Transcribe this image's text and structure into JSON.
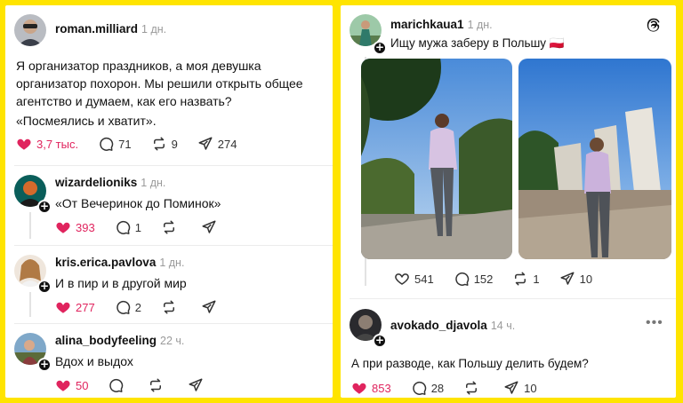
{
  "left_panel": {
    "main_post": {
      "username": "roman.milliard",
      "time": "1 дн.",
      "text": "Я организатор праздников, а моя девушка организатор похорон. Мы решили открыть общее агентство и думаем, как его назвать?",
      "text2": "«Посмеялись и хватит».",
      "likes": "3,7 тыс.",
      "comments": "71",
      "reposts": "9",
      "shares": "274"
    },
    "replies": [
      {
        "username": "wizardelioniks",
        "time": "1 дн.",
        "text": "«От Вечеринок до Поминок»",
        "likes": "393",
        "comments": "1"
      },
      {
        "username": "kris.erica.pavlova",
        "time": "1 дн.",
        "text": "И в пир и в другой мир",
        "likes": "277",
        "comments": "2"
      },
      {
        "username": "alina_bodyfeeling",
        "time": "22 ч.",
        "text": "Вдох и выдох",
        "likes": "50",
        "comments": ""
      }
    ]
  },
  "right_panel": {
    "main_post": {
      "username": "marichkaua1",
      "time": "1 дн.",
      "text": "Ищу мужа заберу в Польшу 🇵🇱",
      "likes": "541",
      "comments": "152",
      "reposts": "1",
      "shares": "10"
    },
    "reply": {
      "username": "avokado_djavola",
      "time": "14 ч.",
      "text": "А при разводе, как Польшу делить будем?",
      "likes": "853",
      "comments": "28",
      "shares": "10"
    }
  },
  "colors": {
    "background": "#FFE400",
    "like_red": "#e0245e"
  },
  "icons": [
    "heart-icon",
    "comment-icon",
    "repost-icon",
    "share-icon",
    "threads-logo-icon",
    "more-icon",
    "follow-plus-icon"
  ]
}
